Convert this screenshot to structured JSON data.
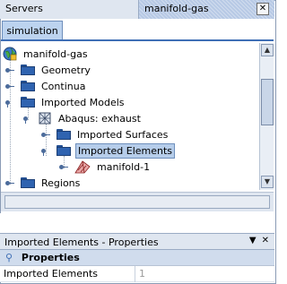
{
  "tabs": {
    "servers": "Servers",
    "active": "manifold-gas",
    "close": "✕"
  },
  "subtab": "simulation",
  "tree": {
    "root": "manifold-gas",
    "geometry": "Geometry",
    "continua": "Continua",
    "imported_models": "Imported Models",
    "abaqus": "Abaqus: exhaust",
    "imported_surfaces": "Imported Surfaces",
    "imported_elements": "Imported Elements",
    "manifold1": "manifold-1",
    "regions": "Regions"
  },
  "props": {
    "title": "Imported Elements - Properties",
    "header": "Properties",
    "row_key": "Imported Elements",
    "row_value": "1"
  },
  "colors": {
    "selection": "#b6cdea",
    "folder": "#2f63b0",
    "accent": "#3f6fb6"
  }
}
